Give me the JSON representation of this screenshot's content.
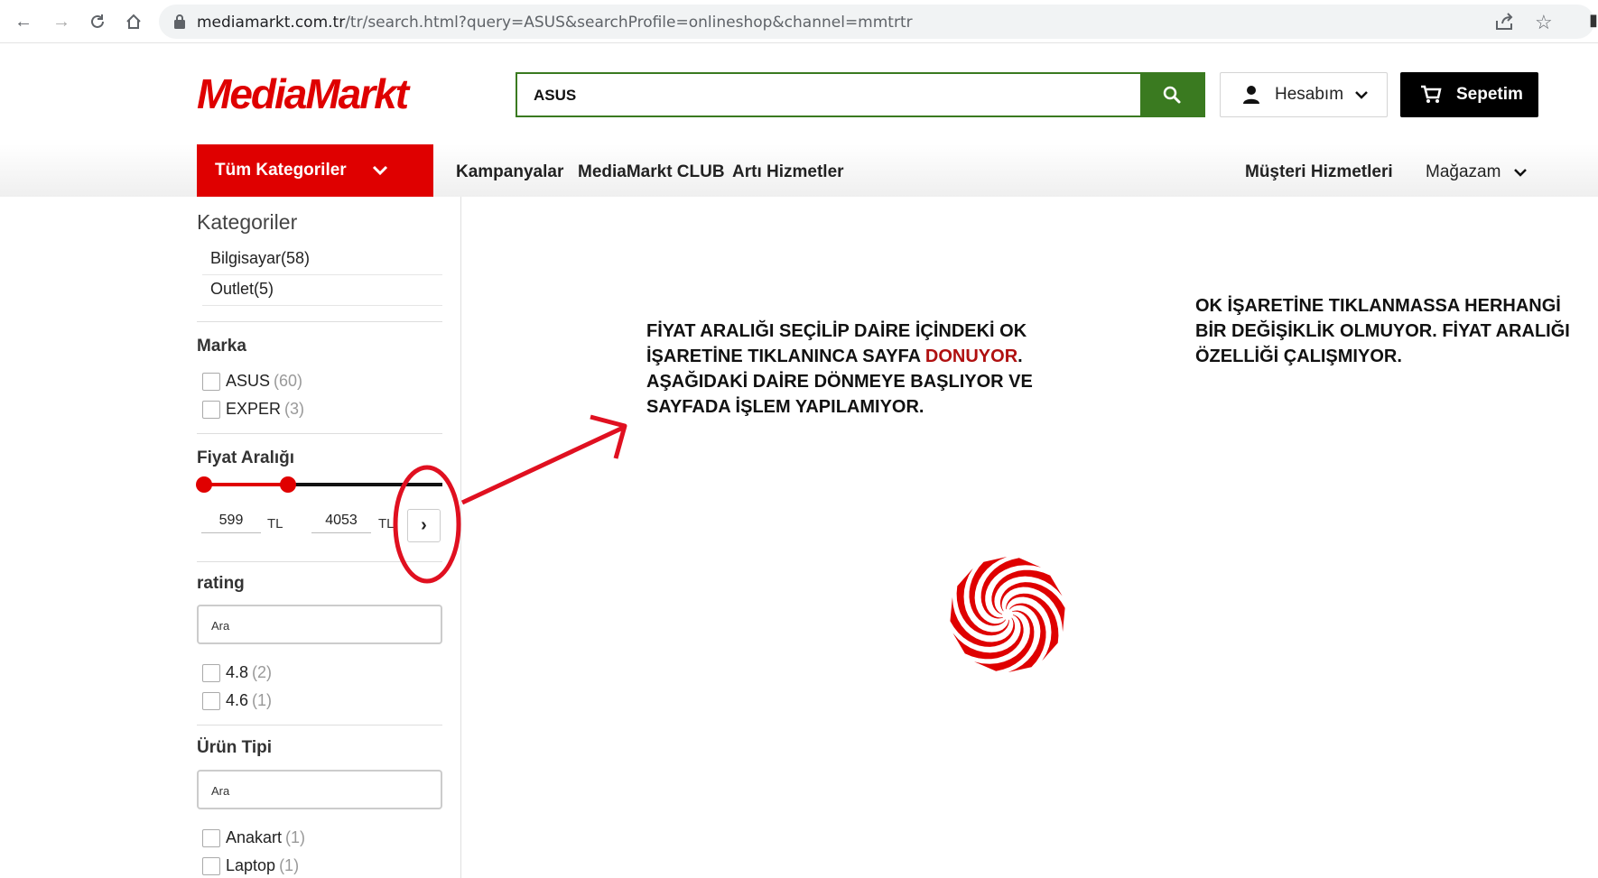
{
  "browser": {
    "url_domain": "mediamarkt.com.tr",
    "url_path": "/tr/search.html?query=ASUS&searchProfile=onlineshop&channel=mmtrtr"
  },
  "header": {
    "logo_text": "MediaMarkt",
    "search_value": "ASUS",
    "account_label": "Hesabım",
    "cart_label": "Sepetim"
  },
  "nav": {
    "all_categories": "Tüm Kategoriler",
    "links": [
      "Kampanyalar",
      "MediaMarkt CLUB",
      "Artı Hizmetler"
    ],
    "customer_service": "Müşteri Hizmetleri",
    "store": "Mağazam"
  },
  "sidebar": {
    "categories_title": "Kategoriler",
    "categories": [
      "Bilgisayar(58)",
      "Outlet(5)"
    ],
    "brand_title": "Marka",
    "brands": [
      {
        "label": "ASUS",
        "count": "(60)"
      },
      {
        "label": "EXPER",
        "count": "(3)"
      }
    ],
    "price_title": "Fiyat Aralığı",
    "price_min": "599",
    "price_max": "4053",
    "price_unit": "TL",
    "price_go": "›",
    "rating_title": "rating",
    "rating_placeholder": "Ara",
    "ratings": [
      {
        "label": "4.8",
        "count": "(2)"
      },
      {
        "label": "4.6",
        "count": "(1)"
      }
    ],
    "product_type_title": "Ürün Tipi",
    "product_type_placeholder": "Ara",
    "product_types": [
      {
        "label": "Anakart",
        "count": "(1)"
      },
      {
        "label": "Laptop",
        "count": "(1)"
      }
    ]
  },
  "annotations": {
    "left_line1": "FİYAT ARALIĞI SEÇİLİP DAİRE İÇİNDEKİ OK",
    "left_line2a": "İŞARETİNE TIKLANINCA SAYFA ",
    "left_line2_red": "DONUYOR",
    "left_line2b": ".",
    "left_line3": "AŞAĞIDAKİ DAİRE DÖNMEYE BAŞLIYOR VE",
    "left_line4": "SAYFADA İŞLEM YAPILAMIYOR.",
    "right_line1": "OK İŞARETİNE TIKLANMASSA HERHANGİ",
    "right_line2": "BİR DEĞİŞİKLİK OLMUYOR. FİYAT ARALIĞI",
    "right_line3": "ÖZELLİĞİ ÇALIŞMIYOR."
  },
  "colors": {
    "brand_red": "#df0000",
    "search_green": "#3a7a20",
    "annotation_red": "#e01020"
  }
}
